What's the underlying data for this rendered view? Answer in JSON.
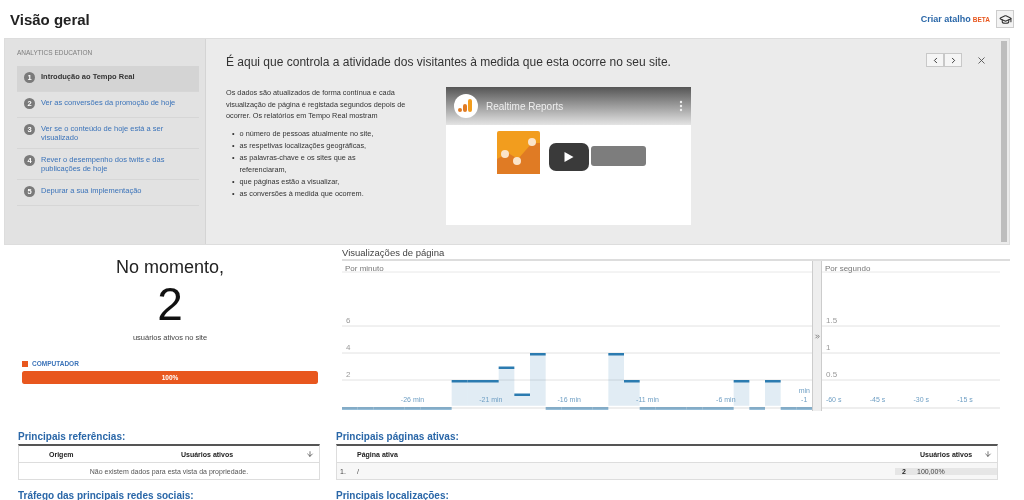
{
  "header": {
    "title": "Visão geral",
    "shortcut_link": "Criar atalho",
    "beta": "BETA"
  },
  "education": {
    "label": "ANALYTICS EDUCATION",
    "steps": [
      {
        "number": "1",
        "label": "Introdução ao Tempo Real",
        "selected": true
      },
      {
        "number": "2",
        "label": "Ver as conversões da promoção de hoje",
        "selected": false
      },
      {
        "number": "3",
        "label": "Ver se o conteúdo de hoje está a ser visualizado",
        "selected": false
      },
      {
        "number": "4",
        "label": "Rever o desempenho dos twits e das publicações de hoje",
        "selected": false
      },
      {
        "number": "5",
        "label": "Depurar a sua implementação",
        "selected": false
      }
    ],
    "headline": "É aqui que controla a atividade dos visitantes à medida que esta ocorre no seu site.",
    "paragraph": "Os dados são atualizados de forma contínua e cada visualização de página é registada segundos depois de ocorrer. Os relatórios em Tempo Real mostram",
    "bullets": [
      {
        "marker": "•",
        "text": "o número de pessoas atualmente no site,"
      },
      {
        "marker": "•",
        "text": "as respetivas localizações geográficas,"
      },
      {
        "marker": "•",
        "text": "as palavras-chave e os sites que as referenciaram,"
      },
      {
        "marker": "•",
        "text": "que páginas estão a visualizar,"
      },
      {
        "marker": "•",
        "text": "as conversões à medida que ocorrem."
      }
    ],
    "video": {
      "title": "Realtime Reports"
    }
  },
  "active": {
    "title": "No momento,",
    "count": "2",
    "caption": "usuários ativos no site",
    "devices": [
      {
        "label": "COMPUTADOR",
        "color": "#e8571e",
        "level": 1,
        "reading": "100%"
      }
    ]
  },
  "pageviews": {
    "title": "Visualizações de página",
    "per_minute": {
      "chart_data": {
        "type": "bar",
        "title": "Por minuto",
        "xlabel": "min",
        "x": [
          -30,
          -29,
          -28,
          -27,
          -26,
          -25,
          -24,
          -23,
          -22,
          -21,
          -20,
          -19,
          -18,
          -17,
          -16,
          -15,
          -14,
          -13,
          -12,
          -11,
          -10,
          -9,
          -8,
          -7,
          -6,
          -5,
          -4,
          -3,
          -2,
          -1
        ],
        "series": [
          {
            "color": "#2b7bb0",
            "values": [
              0,
              0,
              0,
              0,
              0,
              0,
              0,
              2,
              2,
              2,
              3,
              1,
              4,
              0,
              0,
              0,
              0,
              4,
              2,
              0,
              0,
              0,
              0,
              0,
              0,
              2,
              0,
              2,
              0,
              0
            ]
          }
        ],
        "xlim": [
          -30.5,
          -0.5
        ],
        "ylim": [
          0,
          10
        ],
        "yticks": [
          2,
          4,
          6
        ],
        "grid": true,
        "xticks": [
          {
            "value": -26,
            "label": "-26 min"
          },
          {
            "value": -21,
            "label": "-21 min"
          },
          {
            "value": -16,
            "label": "-16 min"
          },
          {
            "value": -11,
            "label": "-11 min"
          },
          {
            "value": -6,
            "label": "-6 min"
          },
          {
            "value": -1,
            "label": "-1"
          }
        ]
      }
    },
    "per_second": {
      "chart_data": {
        "type": "bar",
        "title": "Por segundo",
        "xlim": [
          -64,
          -3
        ],
        "ylim": [
          0,
          2.5
        ],
        "yticks": [
          0.5,
          1,
          1.5
        ],
        "grid": true,
        "xticks": [
          {
            "value": -60,
            "label": "-60 s"
          },
          {
            "value": -45,
            "label": "-45 s"
          },
          {
            "value": -30,
            "label": "-30 s"
          },
          {
            "value": -15,
            "label": "-15 s"
          }
        ]
      }
    }
  },
  "referrals": {
    "title": "Principais referências:",
    "columns": [
      "Origem",
      "Usuários ativos"
    ],
    "empty": "Não existem dados para esta vista da propriedade."
  },
  "active_pages": {
    "title": "Principais páginas ativas:",
    "columns": [
      "Página ativa",
      "Usuários ativos"
    ],
    "rows": [
      {
        "index": "1.",
        "page": "/",
        "users": "2",
        "share": "100,00%"
      }
    ]
  },
  "more_sections": [
    "Tráfego das principais redes sociais:",
    "Principais localizações:"
  ]
}
